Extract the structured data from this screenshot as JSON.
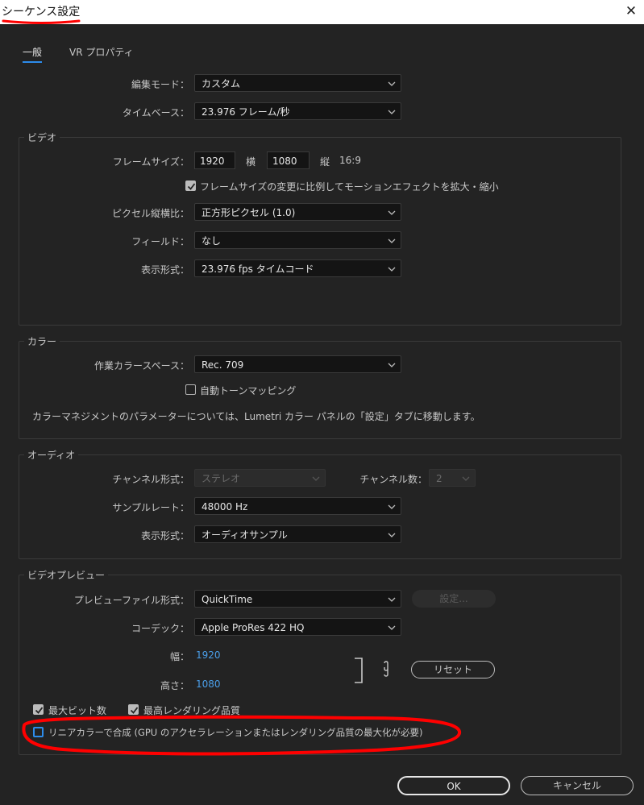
{
  "window": {
    "title": "シーケンス設定",
    "close_glyph": "✕"
  },
  "tabs": [
    {
      "label": "一般"
    },
    {
      "label": "VR プロパティ"
    }
  ],
  "general": {
    "edit_mode": {
      "label": "編集モード：",
      "value": "カスタム"
    },
    "timebase": {
      "label": "タイムベース：",
      "value": "23.976  フレーム/秒"
    }
  },
  "video": {
    "title": "ビデオ",
    "frame_size_label": "フレームサイズ：",
    "width_value": "1920",
    "horizontal_label": "横",
    "height_value": "1080",
    "vertical_label": "縦",
    "aspect": "16:9",
    "scale_checkbox_label": "フレームサイズの変更に比例してモーションエフェクトを拡大・縮小",
    "scale_checked": true,
    "pixel_aspect": {
      "label": "ピクセル縦横比：",
      "value": "正方形ピクセル (1.0)"
    },
    "fields": {
      "label": "フィールド：",
      "value": "なし"
    },
    "display_format": {
      "label": "表示形式：",
      "value": "23.976  fps タイムコード"
    }
  },
  "color": {
    "title": "カラー",
    "working_space": {
      "label": "作業カラースペース：",
      "value": "Rec. 709"
    },
    "tone_mapping_label": "自動トーンマッピング",
    "tone_mapping_checked": false,
    "note": "カラーマネジメントのパラメーターについては、Lumetri カラー パネルの「設定」タブに移動します。"
  },
  "audio": {
    "title": "オーディオ",
    "channel_format": {
      "label": "チャンネル形式：",
      "value": "ステレオ"
    },
    "channel_count": {
      "label": "チャンネル数：",
      "value": "2"
    },
    "sample_rate": {
      "label": "サンプルレート：",
      "value": "48000 Hz"
    },
    "display_format": {
      "label": "表示形式：",
      "value": "オーディオサンプル"
    }
  },
  "preview": {
    "title": "ビデオプレビュー",
    "file_format": {
      "label": "プレビューファイル形式：",
      "value": "QuickTime"
    },
    "settings_button": "設定...",
    "codec": {
      "label": "コーデック：",
      "value": "Apple ProRes 422 HQ"
    },
    "width_label": "幅：",
    "width_value": "1920",
    "height_label": "高さ：",
    "height_value": "1080",
    "reset_button": "リセット",
    "max_bit_depth_label": "最大ビット数",
    "max_bit_depth_checked": true,
    "max_render_quality_label": "最高レンダリング品質",
    "max_render_quality_checked": true,
    "linear_color_label": "リニアカラーで合成 (GPU のアクセラレーションまたはレンダリング品質の最大化が必要)",
    "linear_color_checked": false
  },
  "footer": {
    "ok": "OK",
    "cancel": "キャンセル"
  },
  "colors": {
    "accent": "#2d8ceb",
    "annotation_red": "#ff0000",
    "background": "#232323"
  }
}
